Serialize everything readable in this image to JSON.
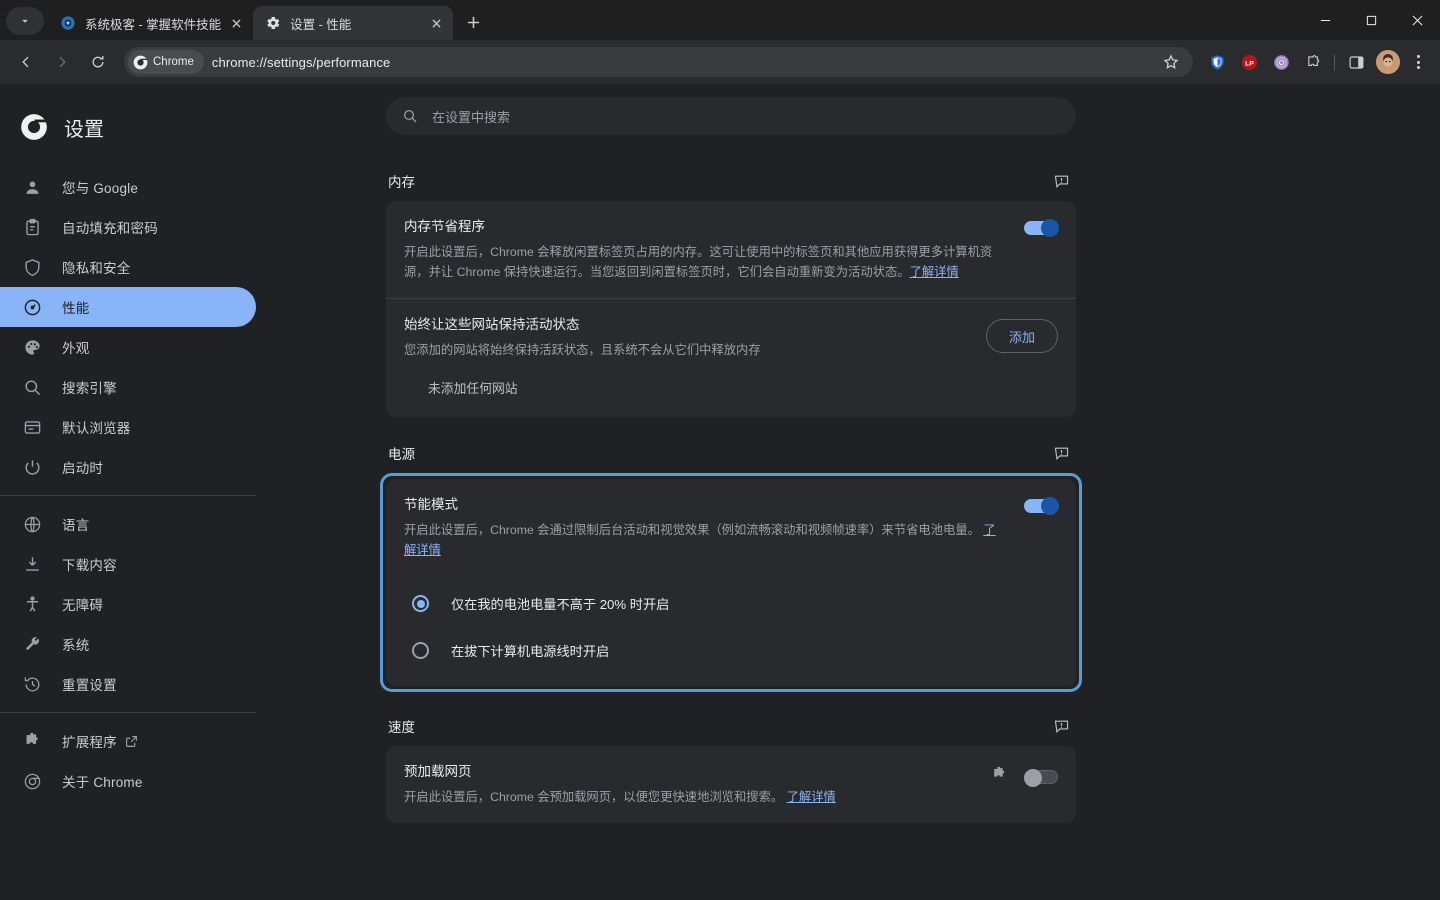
{
  "window": {
    "minimize_label": "最小化",
    "maximize_label": "最大化",
    "close_label": "关闭"
  },
  "tabstrip": {
    "tab_search_label": "搜索标签页",
    "new_tab_label": "新建标签页",
    "tabs": [
      {
        "title": "系统极客 - 掌握软件技能",
        "favicon": "chrome-globe-icon",
        "active": false
      },
      {
        "title": "设置 - 性能",
        "favicon": "gear-icon",
        "active": true
      }
    ]
  },
  "toolbar": {
    "back_label": "返回",
    "forward_label": "前进",
    "reload_label": "重新加载",
    "chrome_chip_label": "Chrome",
    "url": "chrome://settings/performance",
    "bookmark_label": "为此标签页添加书签",
    "extensions": [
      {
        "name": "shield-extension-icon",
        "color": "#2f6fdb"
      },
      {
        "name": "lastpass-extension-icon",
        "color": "#b3151a"
      },
      {
        "name": "openai-extension-icon",
        "color": "#9b7bbf"
      },
      {
        "name": "extensions-puzzle-icon",
        "color": "#c9ccd0"
      }
    ],
    "side_panel_label": "侧边栏",
    "profile_label": "个人资料",
    "menu_label": "自定义及控制 Google Chrome"
  },
  "sidebar": {
    "brand": "设置",
    "brand_icon": "chrome-logo-icon",
    "items": [
      {
        "label": "您与 Google",
        "icon": "person-icon",
        "selected": false
      },
      {
        "label": "自动填充和密码",
        "icon": "clipboard-icon",
        "selected": false
      },
      {
        "label": "隐私和安全",
        "icon": "shield-icon",
        "selected": false
      },
      {
        "label": "性能",
        "icon": "speedometer-icon",
        "selected": true
      },
      {
        "label": "外观",
        "icon": "palette-icon",
        "selected": false
      },
      {
        "label": "搜索引擎",
        "icon": "search-icon",
        "selected": false
      },
      {
        "label": "默认浏览器",
        "icon": "browser-window-icon",
        "selected": false
      },
      {
        "label": "启动时",
        "icon": "power-icon",
        "selected": false
      },
      {
        "label": "语言",
        "icon": "globe-icon",
        "selected": false
      },
      {
        "label": "下载内容",
        "icon": "download-icon",
        "selected": false
      },
      {
        "label": "无障碍",
        "icon": "accessibility-icon",
        "selected": false
      },
      {
        "label": "系统",
        "icon": "wrench-icon",
        "selected": false
      },
      {
        "label": "重置设置",
        "icon": "history-restore-icon",
        "selected": false
      },
      {
        "label": "扩展程序",
        "icon": "puzzle-icon",
        "selected": false,
        "external": true
      },
      {
        "label": "关于 Chrome",
        "icon": "chrome-logo-icon",
        "selected": false
      }
    ]
  },
  "search": {
    "placeholder": "在设置中搜索",
    "value": "",
    "icon": "search-icon"
  },
  "sections": {
    "memory": {
      "title": "内存",
      "feedback_icon": "feedback-icon",
      "memory_saver": {
        "title": "内存节省程序",
        "desc": "开启此设置后，Chrome 会释放闲置标签页占用的内存。这可让使用中的标签页和其他应用获得更多计算机资源，并让 Chrome 保持快速运行。当您返回到闲置标签页时，它们会自动重新变为活动状态。",
        "link": "了解详情",
        "toggle_state": "on"
      },
      "always_active": {
        "title": "始终让这些网站保持活动状态",
        "desc": "您添加的网站将始终保持活跃状态，且系统不会从它们中释放内存",
        "button": "添加",
        "empty": "未添加任何网站"
      }
    },
    "power": {
      "title": "电源",
      "feedback_icon": "feedback-icon",
      "highlighted": true,
      "energy_saver": {
        "title": "节能模式",
        "desc": "开启此设置后，Chrome 会通过限制后台活动和视觉效果（例如流畅滚动和视频帧速率）来节省电池电量。",
        "link": "了解详情",
        "toggle_state": "on",
        "options": [
          {
            "label": "仅在我的电池电量不高于 20% 时开启",
            "checked": true
          },
          {
            "label": "在拔下计算机电源线时开启",
            "checked": false
          }
        ]
      }
    },
    "speed": {
      "title": "速度",
      "feedback_icon": "feedback-icon",
      "preload": {
        "title": "预加载网页",
        "desc": "开启此设置后，Chrome 会预加载网页，以便您更快速地浏览和搜索。",
        "link": "了解详情",
        "extension_icon": "puzzle-icon",
        "toggle_state": "off"
      }
    }
  },
  "colors": {
    "accent": "#8ab4f8",
    "highlight_border": "#5b9bd5",
    "card_bg": "#292a2d",
    "page_bg": "#202124",
    "link": "#8ab4f8"
  }
}
